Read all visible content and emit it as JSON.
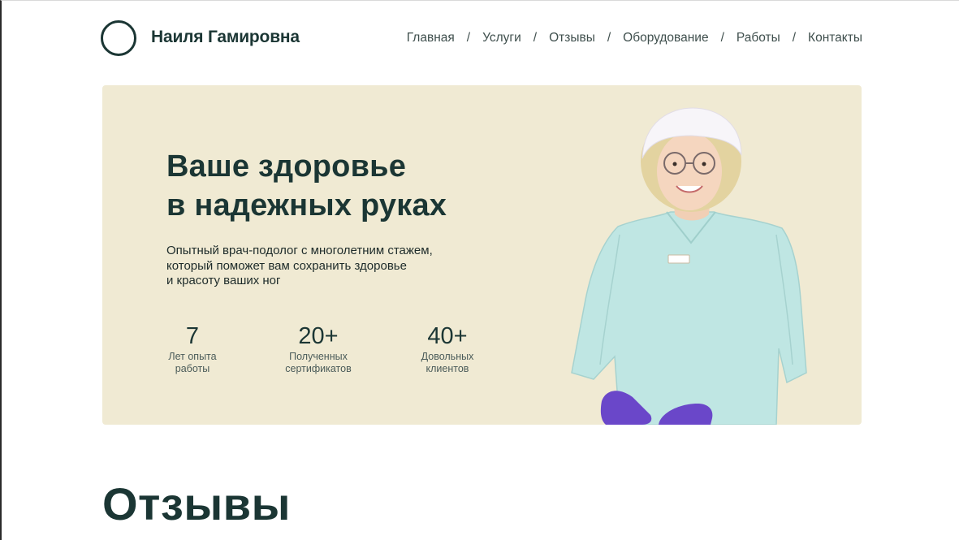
{
  "header": {
    "brand_name": "Наиля Гамировна",
    "nav": [
      {
        "label": "Главная"
      },
      {
        "label": "Услуги"
      },
      {
        "label": "Отзывы"
      },
      {
        "label": "Оборудование"
      },
      {
        "label": "Работы"
      },
      {
        "label": "Контакты"
      }
    ],
    "separator": "/"
  },
  "hero": {
    "title_line1": "Ваше здоровье",
    "title_line2": "в надежных руках",
    "subtitle_line1": "Опытный врач-подолог с многолетним стажем,",
    "subtitle_line2": "который поможет вам сохранить здоровье",
    "subtitle_line3": "и красоту ваших ног",
    "stats": [
      {
        "value": "7",
        "label_line1": "Лет опыта",
        "label_line2": "работы"
      },
      {
        "value": "20+",
        "label_line1": "Полученных",
        "label_line2": "сертификатов"
      },
      {
        "value": "40+",
        "label_line1": "Довольных",
        "label_line2": "клиентов"
      }
    ]
  },
  "reviews": {
    "title": "Отзывы"
  },
  "colors": {
    "primary": "#1b3634",
    "hero_bg": "#f0ead3",
    "scrub": "#bfe6e3",
    "gloves": "#6a47c9"
  }
}
